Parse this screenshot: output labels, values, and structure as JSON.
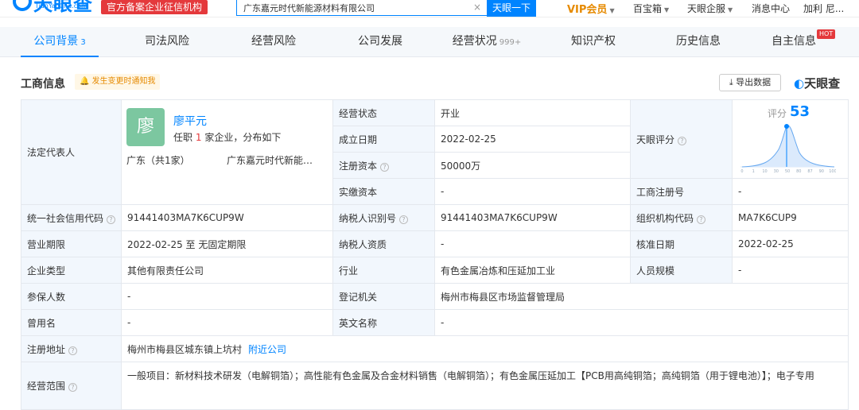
{
  "header": {
    "logo_text": "天眼查",
    "logo_sub": "TianYanCha.com",
    "cert_badge": "官方备案企业征信机构",
    "search_value": "广东嘉元时代新能源材料有限公司",
    "search_clear": "×",
    "search_button": "天眼一下",
    "vip": "VIP会员",
    "nav": [
      "百宝箱",
      "天眼企服",
      "消息中心",
      "加利 尼..."
    ]
  },
  "tabs": [
    {
      "label": "公司背景",
      "count": "3"
    },
    {
      "label": "司法风险",
      "count": ""
    },
    {
      "label": "经营风险",
      "count": ""
    },
    {
      "label": "公司发展",
      "count": ""
    },
    {
      "label": "经营状况",
      "count": "999+"
    },
    {
      "label": "知识产权",
      "count": ""
    },
    {
      "label": "历史信息",
      "count": ""
    },
    {
      "label": "自主信息",
      "count": ""
    }
  ],
  "hot_badge": "HOT",
  "section": {
    "title": "工商信息",
    "notify": "发生变更时通知我",
    "export": "导出数据",
    "brand": "天眼查"
  },
  "info": {
    "legal_rep_label": "法定代表人",
    "legal_rep": {
      "avatar_char": "廖",
      "name": "廖平元",
      "desc_prefix": "任职",
      "desc_count": "1",
      "desc_suffix": "家企业，分布如下",
      "region": "广东（共1家）",
      "company": "广东嘉元时代新能源..."
    },
    "status_label": "经营状态",
    "status": "开业",
    "found_label": "成立日期",
    "found": "2022-02-25",
    "capital_label": "注册资本",
    "capital": "50000万",
    "paid_label": "实缴资本",
    "paid": "-",
    "score_label": "天眼评分",
    "score_title": "评分",
    "score": "53",
    "score_ticks": [
      "0",
      "1",
      "10",
      "30",
      "50",
      "80",
      "87",
      "90",
      "100"
    ],
    "reg_no_label": "工商注册号",
    "reg_no": "-",
    "credit_code_label": "统一社会信用代码",
    "credit_code": "91441403MA7K6CUP9W",
    "taxpayer_id_label": "纳税人识别号",
    "taxpayer_id": "91441403MA7K6CUP9W",
    "org_code_label": "组织机构代码",
    "org_code": "MA7K6CUP9",
    "term_label": "营业期限",
    "term": "2022-02-25  至  无固定期限",
    "taxpayer_qual_label": "纳税人资质",
    "taxpayer_qual": "-",
    "approve_label": "核准日期",
    "approve": "2022-02-25",
    "type_label": "企业类型",
    "type": "其他有限责任公司",
    "industry_label": "行业",
    "industry": "有色金属冶炼和压延加工业",
    "staff_label": "人员规模",
    "staff": "-",
    "insured_label": "参保人数",
    "insured": "-",
    "authority_label": "登记机关",
    "authority": "梅州市梅县区市场监督管理局",
    "former_label": "曾用名",
    "former": "-",
    "en_label": "英文名称",
    "en": "-",
    "address_label": "注册地址",
    "address": "梅州市梅县区城东镇上坑村",
    "nearby": "附近公司",
    "scope_label": "经营范围",
    "scope": "一般项目：新材料技术研发（电解铜箔）；高性能有色金属及合金材料销售（电解铜箔）；有色金属压延加工【PCB用高纯铜箔；高纯铜箔（用于锂电池）】；电子专用"
  }
}
